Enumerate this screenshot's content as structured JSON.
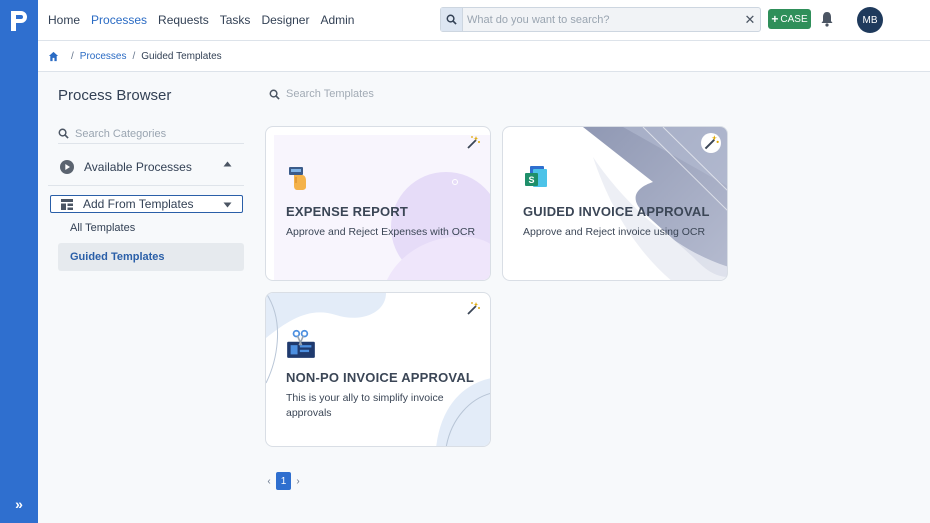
{
  "nav": {
    "items": [
      {
        "label": "Home",
        "active": false
      },
      {
        "label": "Processes",
        "active": true
      },
      {
        "label": "Requests",
        "active": false
      },
      {
        "label": "Tasks",
        "active": false
      },
      {
        "label": "Designer",
        "active": false
      },
      {
        "label": "Admin",
        "active": false
      }
    ],
    "search_placeholder": "What do you want to search?",
    "case_label": "CASE",
    "avatar_initials": "MB"
  },
  "breadcrumb": {
    "processes": "Processes",
    "current": "Guided Templates"
  },
  "sidebar": {
    "title": "Process Browser",
    "search_placeholder": "Search Categories",
    "available_processes": "Available Processes",
    "add_from_templates": "Add From Templates",
    "all_templates": "All Templates",
    "guided_templates": "Guided Templates"
  },
  "main": {
    "search_placeholder": "Search Templates",
    "cards": [
      {
        "title": "EXPENSE REPORT",
        "description": "Approve and Reject Expenses with OCR"
      },
      {
        "title": "GUIDED INVOICE APPROVAL",
        "description": "Approve and Reject invoice using OCR"
      },
      {
        "title": "NON-PO INVOICE APPROVAL",
        "description": "This is your ally to simplify invoice approvals"
      }
    ],
    "pagination": {
      "current_page": "1",
      "prev": "‹",
      "next": "›"
    }
  },
  "colors": {
    "rail": "#2f6fcf",
    "accent": "#2a6bc4",
    "case_button": "#2f8f5a",
    "avatar": "#1f3a5c"
  }
}
